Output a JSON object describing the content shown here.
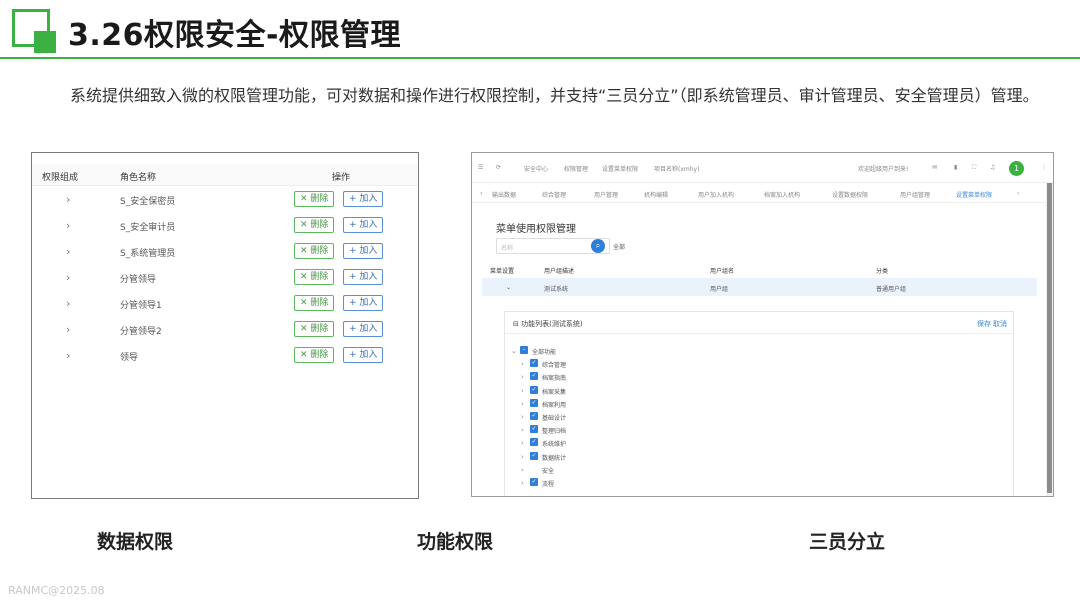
{
  "slide": {
    "title": "3.26权限安全-权限管理",
    "description": "系统提供细致入微的权限管理功能，可对数据和操作进行权限控制，并支持“三员分立”（即系统管理员、审计管理员、安全管理员）管理。",
    "footer": "RANMC@2025.08",
    "accent_color": "#3cb043"
  },
  "data_panel": {
    "columns": [
      "权限组成",
      "角色名称",
      "操作"
    ],
    "delete_label": "删除",
    "add_label": "加入",
    "rows": [
      {
        "name": "S_安全保密员"
      },
      {
        "name": "S_安全审计员"
      },
      {
        "name": "S_系统管理员"
      },
      {
        "name": "分管领导"
      },
      {
        "name": "分管领导1"
      },
      {
        "name": "分管领导2"
      },
      {
        "name": "领导"
      }
    ]
  },
  "func_panel": {
    "topbar": {
      "items": [
        "安全中心",
        "权限管理",
        "设置菜单权限",
        "项目名称(xmhy)"
      ],
      "welcome": "欢迎超级用户到来!",
      "avatar_text": "1"
    },
    "tabs": [
      "输出数据",
      "综合管理",
      "用户管理",
      "机构编辑",
      "用户加入机构",
      "档案加入机构",
      "设置数据权限",
      "用户组管理",
      "设置菜单权限"
    ],
    "active_tab": "设置菜单权限",
    "section_title": "菜单使用权限管理",
    "search_placeholder": "名称",
    "search_all": "全部",
    "table_headers": [
      "菜单设置",
      "用户组描述",
      "用户组名",
      "分类"
    ],
    "table_row": {
      "desc": "测试系统",
      "group": "用户组",
      "category": "普通用户组"
    },
    "function_list_title": "功能列表(测试系统)",
    "save_label": "保存",
    "cancel_label": "取消",
    "tree_root": "全部功能",
    "tree_items": [
      {
        "label": "综合管理",
        "checked": true
      },
      {
        "label": "档案指南",
        "checked": true
      },
      {
        "label": "档案采集",
        "checked": true
      },
      {
        "label": "档案利用",
        "checked": true
      },
      {
        "label": "基础设计",
        "checked": true
      },
      {
        "label": "整理归档",
        "checked": true
      },
      {
        "label": "系统维护",
        "checked": true
      },
      {
        "label": "数据统计",
        "checked": true
      },
      {
        "label": "安全",
        "checked": false
      },
      {
        "label": "流程",
        "checked": true
      }
    ]
  },
  "captions": [
    "数据权限",
    "功能权限",
    "三员分立"
  ]
}
